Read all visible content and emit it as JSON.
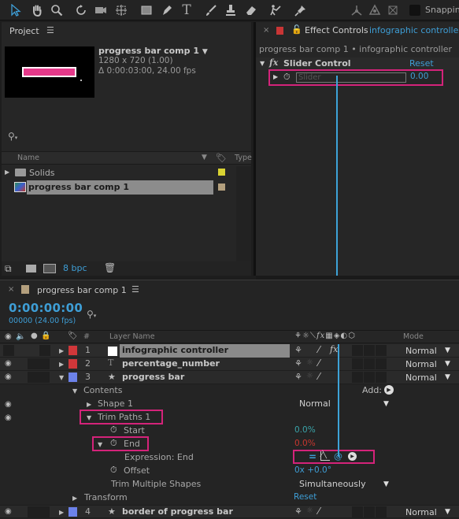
{
  "toolbar": {
    "tools": [
      "selection-tool",
      "hand-tool",
      "zoom-tool",
      "rotation-tool",
      "camera-tool",
      "pan-behind-tool",
      "rectangle-tool",
      "pen-tool",
      "type-tool",
      "brush-tool",
      "clone-stamp-tool",
      "eraser-tool",
      "roto-brush-tool",
      "puppet-pin-tool",
      "local-axis-mode",
      "world-axis-mode",
      "view-axis-mode"
    ],
    "snapping_label": "Snappin"
  },
  "project": {
    "title": "Project",
    "comp_name": "progress bar comp 1",
    "comp_res": "1280 x 720 (1.00)",
    "comp_duration": "Δ 0:00:03:00, 24.00 fps",
    "thumbnail_bar_color": "#e5398a",
    "columns": {
      "name": "Name",
      "type": "Type"
    },
    "items": [
      {
        "name": "Solids",
        "kind": "folder",
        "label_color": "#d9d332",
        "type": "F"
      },
      {
        "name": "progress bar comp 1",
        "kind": "composition",
        "label_color": "#b39f7d",
        "type": "C",
        "selected": true
      }
    ],
    "bit_depth": "8 bpc"
  },
  "effect_controls": {
    "title": "Effect Controls",
    "layer": "infographic controller",
    "breadcrumb": "progress bar comp 1 • infographic controller",
    "effect_name": "Slider Control",
    "reset_label": "Reset",
    "slider_label": "Slider",
    "slider_value": "0.00"
  },
  "timeline": {
    "comp_tab": "progress bar comp 1",
    "timecode": "0:00:00:00",
    "frames": "00000 (24.00 fps)",
    "columns": {
      "num": "#",
      "layer_name": "Layer Name",
      "mode": "Mode"
    },
    "layers": [
      {
        "num": "1",
        "name": "infographic controller",
        "color": "#d1373a",
        "type": "solid",
        "mode": "Normal",
        "selected": true,
        "has_fx": true
      },
      {
        "num": "2",
        "name": "percentage_number",
        "color": "#d1373a",
        "type": "text",
        "mode": "Normal"
      },
      {
        "num": "3",
        "name": "progress bar",
        "color": "#6c82ea",
        "type": "shape",
        "mode": "Normal",
        "expanded": true
      },
      {
        "num": "4",
        "name": "border of progress bar",
        "color": "#6c82ea",
        "type": "shape",
        "mode": "Normal"
      }
    ],
    "properties": {
      "contents": "Contents",
      "add_label": "Add:",
      "shape1": "Shape 1",
      "shape1_mode": "Normal",
      "trim_paths": "Trim Paths 1",
      "start": "Start",
      "start_value": "0.0%",
      "end": "End",
      "end_value": "0.0%",
      "expression_label": "Expression: End",
      "offset": "Offset",
      "offset_value": "0x +0.0°",
      "trim_multiple": "Trim Multiple Shapes",
      "trim_multiple_value": "Simultaneously",
      "transform": "Transform",
      "transform_reset": "Reset"
    }
  },
  "colors": {
    "accent_blue": "#3e9ed6",
    "highlight_pink": "#d4237a",
    "value_red": "#c8372f"
  }
}
